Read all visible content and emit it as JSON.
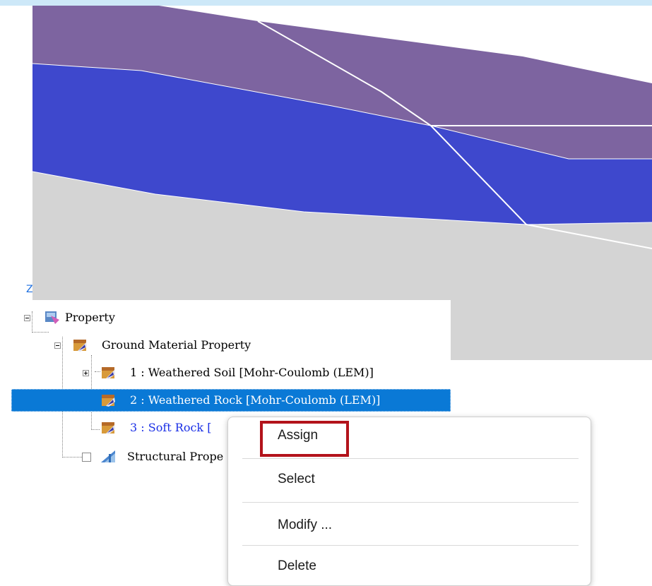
{
  "colors": {
    "layer_top": "#7d64a0",
    "layer_middle": "#3e48cd",
    "layer_bottom": "#d4d4d4",
    "selection": "#0a79d6",
    "soft_rock_text": "#1a2fe6",
    "highlight_box": "#b3131b"
  },
  "viewport": {
    "axis_label": "Z"
  },
  "tree": {
    "root": {
      "label": "Property",
      "icon": "property-icon",
      "expanded": true
    },
    "ground": {
      "label": "Ground Material Property",
      "icon": "ground-material-icon",
      "expanded": true
    },
    "items": [
      {
        "label": "1 : Weathered Soil [Mohr-Coulomb (LEM)]",
        "icon": "material-icon",
        "expander": "plus"
      },
      {
        "label": "2 : Weathered Rock [Mohr-Coulomb (LEM)]",
        "icon": "material-icon",
        "selected": true
      },
      {
        "label": "3 : Soft Rock [",
        "icon": "material-icon"
      }
    ],
    "structural": {
      "label": "Structural Prope",
      "icon": "structural-icon",
      "checked": false
    }
  },
  "context_menu": {
    "items": [
      {
        "label": "Assign",
        "highlighted": true
      },
      {
        "label": "Select"
      },
      {
        "label": "Modify ..."
      },
      {
        "label": "Delete"
      }
    ]
  }
}
